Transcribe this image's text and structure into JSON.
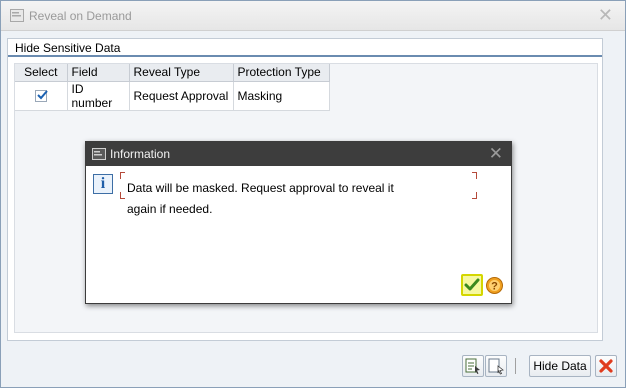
{
  "window": {
    "title": "Reveal on Demand",
    "close_glyph": "✕"
  },
  "group": {
    "title": "Hide Sensitive Data"
  },
  "grid": {
    "headers": {
      "select": "Select",
      "field": "Field",
      "reveal_type": "Reveal Type",
      "protection_type": "Protection Type"
    },
    "rows": [
      {
        "selected": true,
        "field": "ID number",
        "reveal_type": "Request Approval",
        "protection_type": "Masking"
      }
    ]
  },
  "popup": {
    "title": "Information",
    "close_glyph": "✕",
    "info_glyph": "i",
    "message_line1": "Data will be masked. Request approval to reveal it",
    "message_line2": "again if needed.",
    "icons": {
      "ok": "checkmark-icon",
      "help": "help-icon"
    }
  },
  "footer": {
    "hide_data_label": "Hide Data",
    "icons": {
      "select_all": "select-all-icon",
      "deselect": "deselect-all-icon",
      "cancel": "cancel-icon"
    }
  },
  "colors": {
    "popup_title_bg": "#3d3d3d",
    "group_header_line": "#6a8bb0",
    "ok_highlight": "#d4d600",
    "cancel_red": "#e03c1e",
    "help_orange": "#f0a020"
  }
}
